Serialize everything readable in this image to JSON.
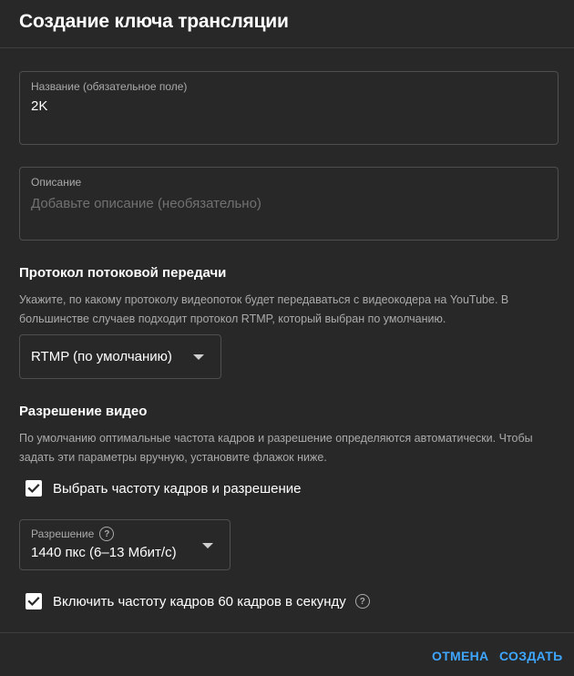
{
  "dialog": {
    "title": "Создание ключа трансляции"
  },
  "name_field": {
    "label": "Название (обязательное поле)",
    "value": "2K"
  },
  "description_field": {
    "label": "Описание",
    "placeholder": "Добавьте описание (необязательно)",
    "value": ""
  },
  "protocol": {
    "title": "Протокол потоковой передачи",
    "description": "Укажите, по какому протоколу видеопоток будет передаваться с видеокодера на YouTube. В большинстве случаев подходит протокол RTMP, который выбран по умолчанию.",
    "selected": "RTMP (по умолчанию)",
    "icon": "chevron-down-icon"
  },
  "resolution": {
    "title": "Разрешение видео",
    "description": "По умолчанию оптимальные частота кадров и разрешение определяются автоматически. Чтобы задать эти параметры вручную, установите флажок ниже.",
    "manual_checkbox": {
      "label": "Выбрать частоту кадров и разрешение",
      "checked": true
    },
    "resolution_select": {
      "label": "Разрешение",
      "selected": "1440 пкс (6–13 Мбит/с)",
      "help_icon": "?"
    },
    "fps60_checkbox": {
      "label": "Включить частоту кадров 60 кадров в секунду",
      "checked": true,
      "help_icon": "?"
    }
  },
  "footer": {
    "cancel_label": "ОТМЕНА",
    "create_label": "СОЗДАТЬ"
  },
  "colors": {
    "background": "#282828",
    "accent": "#3ea6ff",
    "border": "#4f4f4f",
    "secondary_text": "#aaaaaa"
  }
}
